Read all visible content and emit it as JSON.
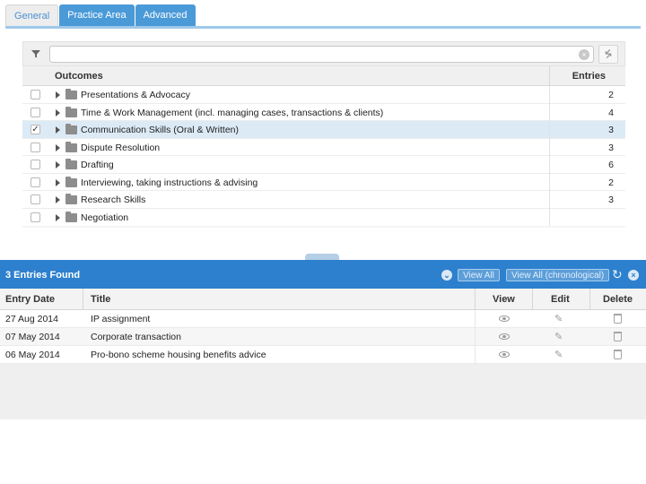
{
  "tabs": [
    {
      "label": "General",
      "active": true
    },
    {
      "label": "Practice Area",
      "active": false
    },
    {
      "label": "Advanced",
      "active": false
    }
  ],
  "filter": {
    "value": "",
    "placeholder": ""
  },
  "outcomes": {
    "header": {
      "title": "Outcomes",
      "entries": "Entries"
    },
    "rows": [
      {
        "label": "Presentations & Advocacy",
        "count": "2",
        "checked": false
      },
      {
        "label": "Time & Work Management (incl. managing cases, transactions & clients)",
        "count": "4",
        "checked": false
      },
      {
        "label": "Communication Skills (Oral & Written)",
        "count": "3",
        "checked": true
      },
      {
        "label": "Dispute Resolution",
        "count": "3",
        "checked": false
      },
      {
        "label": "Drafting",
        "count": "6",
        "checked": false
      },
      {
        "label": "Interviewing, taking instructions & advising",
        "count": "2",
        "checked": false
      },
      {
        "label": "Research Skills",
        "count": "3",
        "checked": false
      },
      {
        "label": "Negotiation",
        "count": "",
        "checked": false
      }
    ]
  },
  "entries": {
    "found_label": "3 Entries Found",
    "view_all_label": "View All",
    "view_all_chrono_label": "View All (chronological)",
    "columns": {
      "date": "Entry Date",
      "title": "Title",
      "view": "View",
      "edit": "Edit",
      "delete": "Delete"
    },
    "rows": [
      {
        "date": "27 Aug 2014",
        "title": "IP assignment"
      },
      {
        "date": "07 May 2014",
        "title": "Corporate transaction"
      },
      {
        "date": "06 May 2014",
        "title": "Pro-bono scheme housing benefits advice"
      }
    ]
  },
  "colors": {
    "accent": "#2d80cd",
    "tab_blue": "#4a9ad8",
    "selected_row": "#dceaf6"
  }
}
